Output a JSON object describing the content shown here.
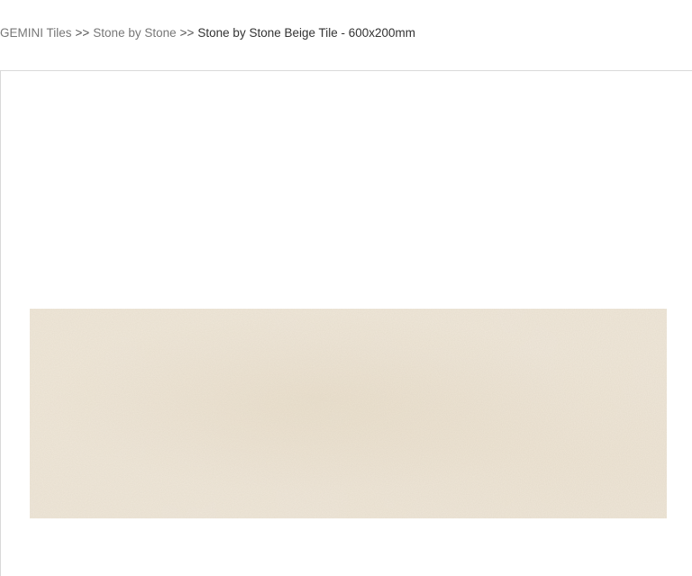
{
  "breadcrumb": {
    "items": [
      {
        "label": "GEMINI Tiles"
      },
      {
        "label": "Stone by Stone"
      }
    ],
    "separator": ">>",
    "current": "Stone by Stone Beige Tile - 600x200mm"
  },
  "product_image": {
    "tile_color": "#efe7da"
  }
}
